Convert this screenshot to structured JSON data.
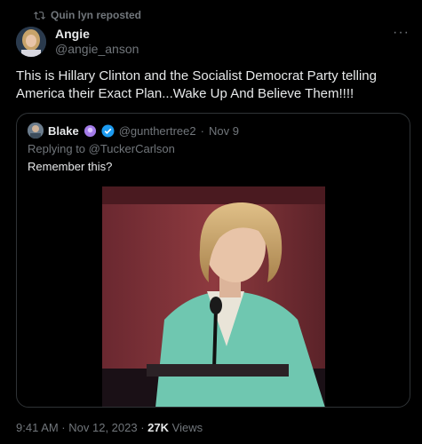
{
  "repost": {
    "label": "Quin lyn reposted",
    "icon": "repost-icon"
  },
  "author": {
    "name": "Angie",
    "handle": "@angie_anson"
  },
  "tweet_text": "This is Hillary Clinton and the Socialist Democrat Party telling America their Exact Plan...Wake Up And Believe Them!!!!",
  "quoted": {
    "name": "Blake",
    "handle": "@gunthertree2",
    "separator": "·",
    "date": "Nov 9",
    "replying_to": "Replying to @TuckerCarlson",
    "text": "Remember this?"
  },
  "meta": {
    "timestamp": "9:41 AM · Nov 12, 2023 ·",
    "views_count": "27K",
    "views_label": "Views"
  },
  "colors": {
    "verified": "#1d9bf0",
    "badge": "#a37be8",
    "muted": "#71767b",
    "text": "#e7e9ea",
    "border": "#2f3336"
  }
}
